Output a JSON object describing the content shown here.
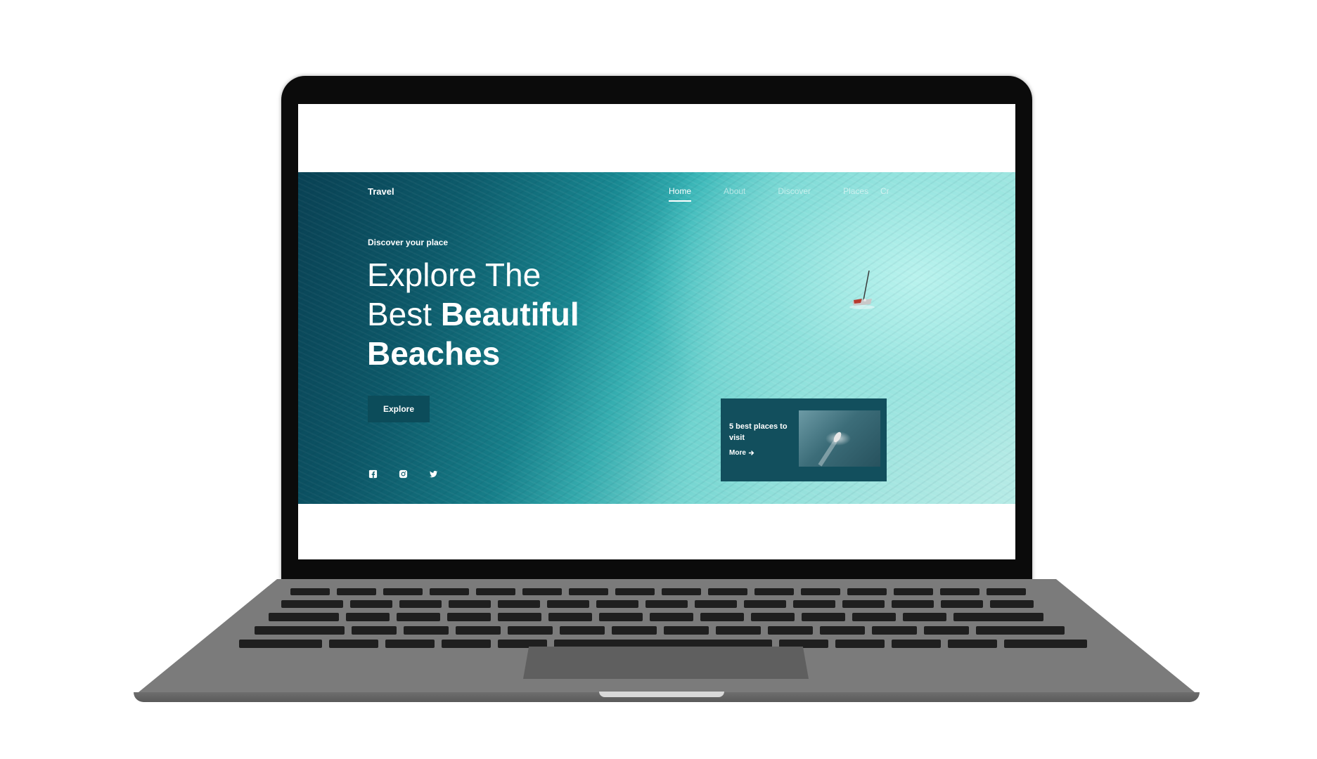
{
  "site": {
    "logo": "Travel",
    "nav": [
      {
        "label": "Home",
        "active": true
      },
      {
        "label": "About",
        "active": false
      },
      {
        "label": "Discover",
        "active": false
      },
      {
        "label": "Places",
        "active": false
      }
    ],
    "nav_extra": "Cr"
  },
  "hero": {
    "eyebrow": "Discover your place",
    "headline_line1": "Explore The",
    "headline_line2_light": "Best ",
    "headline_line2_bold": "Beautiful",
    "headline_line3": "Beaches",
    "cta_label": "Explore",
    "socials": [
      "facebook-icon",
      "instagram-icon",
      "twitter-icon"
    ]
  },
  "card": {
    "title": "5 best places to visit",
    "more_label": "More",
    "more_icon": "arrow-right-icon"
  },
  "colors": {
    "accent_dark": "#0c4c5a",
    "card_bg": "#124f5d",
    "laptop_body": "#7b7b7b",
    "bezel": "#0b0b0b"
  }
}
